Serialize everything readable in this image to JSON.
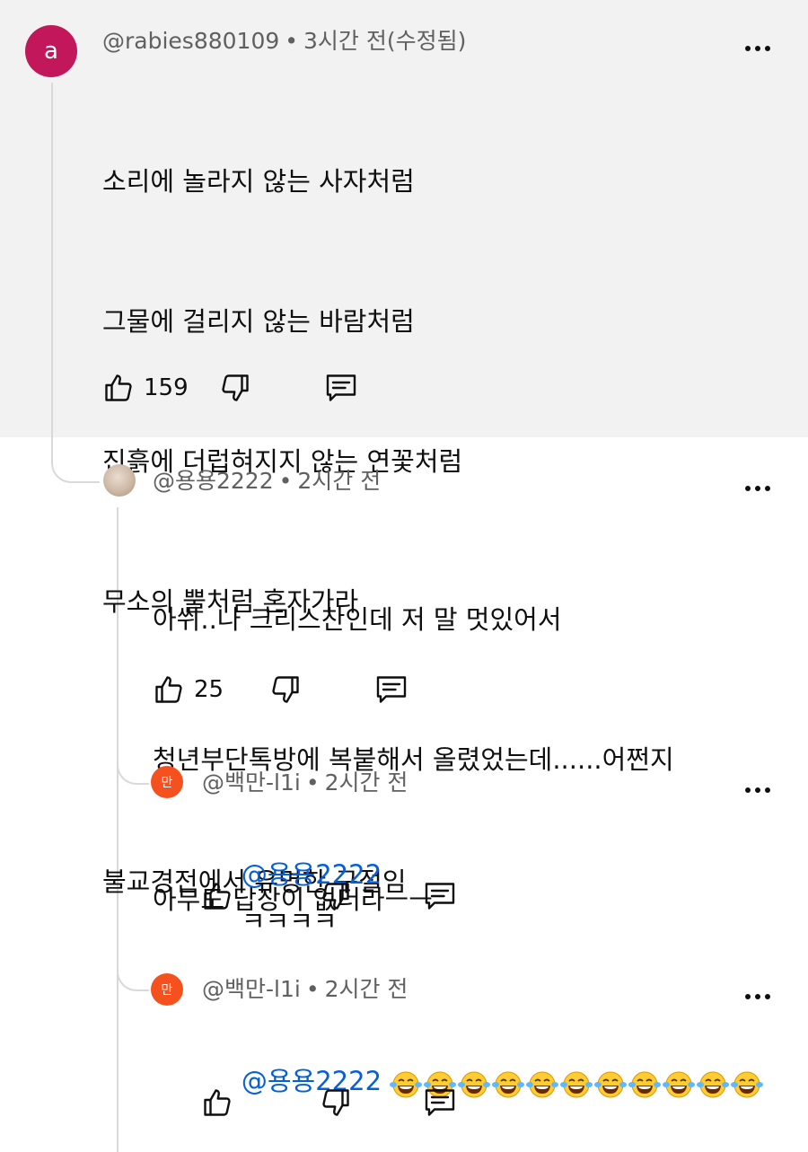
{
  "comments": [
    {
      "avatar_letter": "a",
      "avatar_color": "#c2185b",
      "author": "@rabies880109",
      "time": "3시간 전(수정됨)",
      "lines": [
        "소리에 놀라지 않는 사자처럼",
        "그물에 걸리지 않는 바람처럼",
        "진흙에 더럽혀지지 않는 연꽃처럼",
        "무소의 뿔처럼 혼자가라",
        "",
        "불교경전에서 유명한 구절임"
      ],
      "likes": "159"
    },
    {
      "author": "@용용2222",
      "time": "2시간 전",
      "lines": [
        "아쒸..나 크리스찬인데 저 말 멋있어서",
        "청년부단톡방에 복붙해서 올렸었는데......어쩐지",
        "아무도 답장이 없더라ㅡㅡ"
      ],
      "likes": "25"
    },
    {
      "avatar_letter": "만",
      "avatar_color": "#f4511e",
      "author": "@백만-l1i",
      "time": "2시간 전",
      "mention": "@용용2222",
      "text": "ㅋㅋㅋㅋ"
    },
    {
      "avatar_letter": "만",
      "avatar_color": "#f4511e",
      "author": "@백만-l1i",
      "time": "2시간 전",
      "mention": "@용용2222",
      "emoji_name": "face-with-tears-of-joy",
      "emoji_count": 11
    }
  ],
  "separator": "•",
  "icons": {
    "like": "thumbs-up-icon",
    "dislike": "thumbs-down-icon",
    "reply": "reply-icon",
    "more": "more-vert-icon"
  }
}
